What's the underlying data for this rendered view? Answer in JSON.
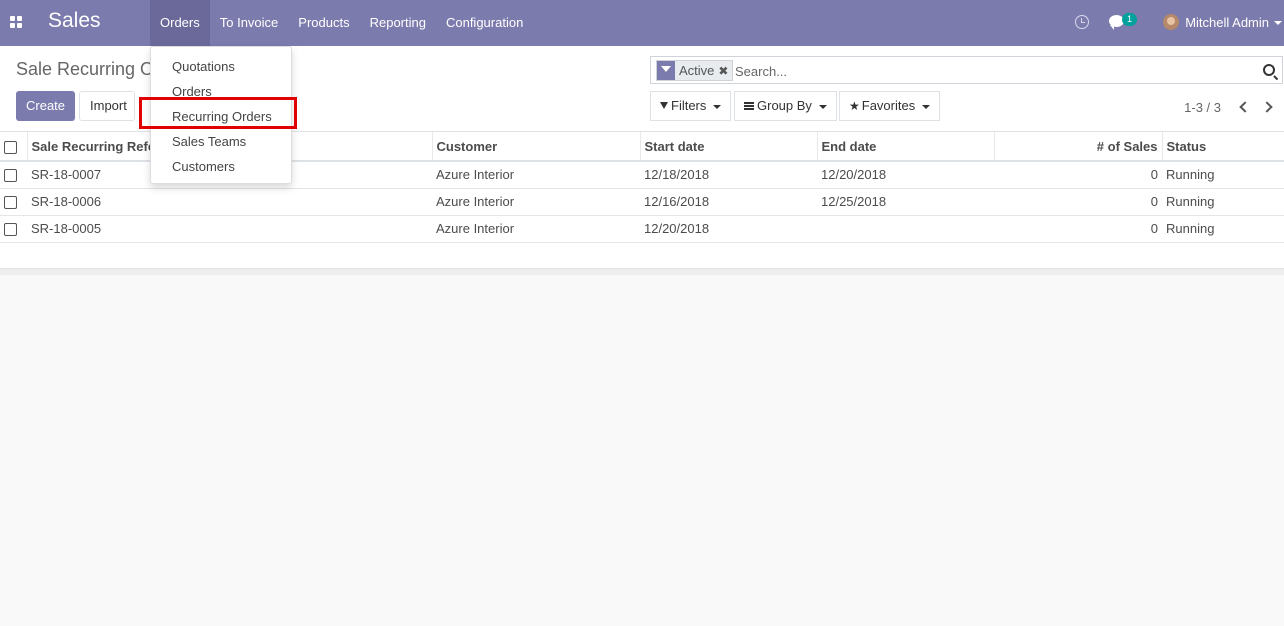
{
  "navbar": {
    "brand": "Sales",
    "menu": [
      {
        "label": "Orders",
        "active": true
      },
      {
        "label": "To Invoice"
      },
      {
        "label": "Products"
      },
      {
        "label": "Reporting"
      },
      {
        "label": "Configuration"
      }
    ],
    "chat_count": "1",
    "user_name": "Mitchell Admin",
    "colors": {
      "navbar_bg": "#7c7bad",
      "badge": "#00a09d",
      "highlight_box": "#e00000"
    }
  },
  "breadcrumb": "Sale Recurring Orders",
  "buttons": {
    "create": "Create",
    "import": "Import"
  },
  "search": {
    "facet_label": "Active",
    "facet_remove": "✖",
    "placeholder": "Search..."
  },
  "search_buttons": {
    "filters": "Filters",
    "group_by": "Group By",
    "favorites": "Favorites"
  },
  "pager": "1-3 / 3",
  "table": {
    "columns": [
      "Sale Recurring Reference",
      "Customer",
      "Start date",
      "End date",
      "# of Sales",
      "Status"
    ],
    "rows": [
      {
        "ref": "SR-18-0007",
        "customer": "Azure Interior",
        "start": "12/18/2018",
        "end": "12/20/2018",
        "sales": "0",
        "status": "Running"
      },
      {
        "ref": "SR-18-0006",
        "customer": "Azure Interior",
        "start": "12/16/2018",
        "end": "12/25/2018",
        "sales": "0",
        "status": "Running"
      },
      {
        "ref": "SR-18-0005",
        "customer": "Azure Interior",
        "start": "12/20/2018",
        "end": "",
        "sales": "0",
        "status": "Running"
      }
    ]
  },
  "dropdown": {
    "items": [
      "Quotations",
      "Orders",
      "Recurring Orders",
      "Sales Teams",
      "Customers"
    ]
  }
}
